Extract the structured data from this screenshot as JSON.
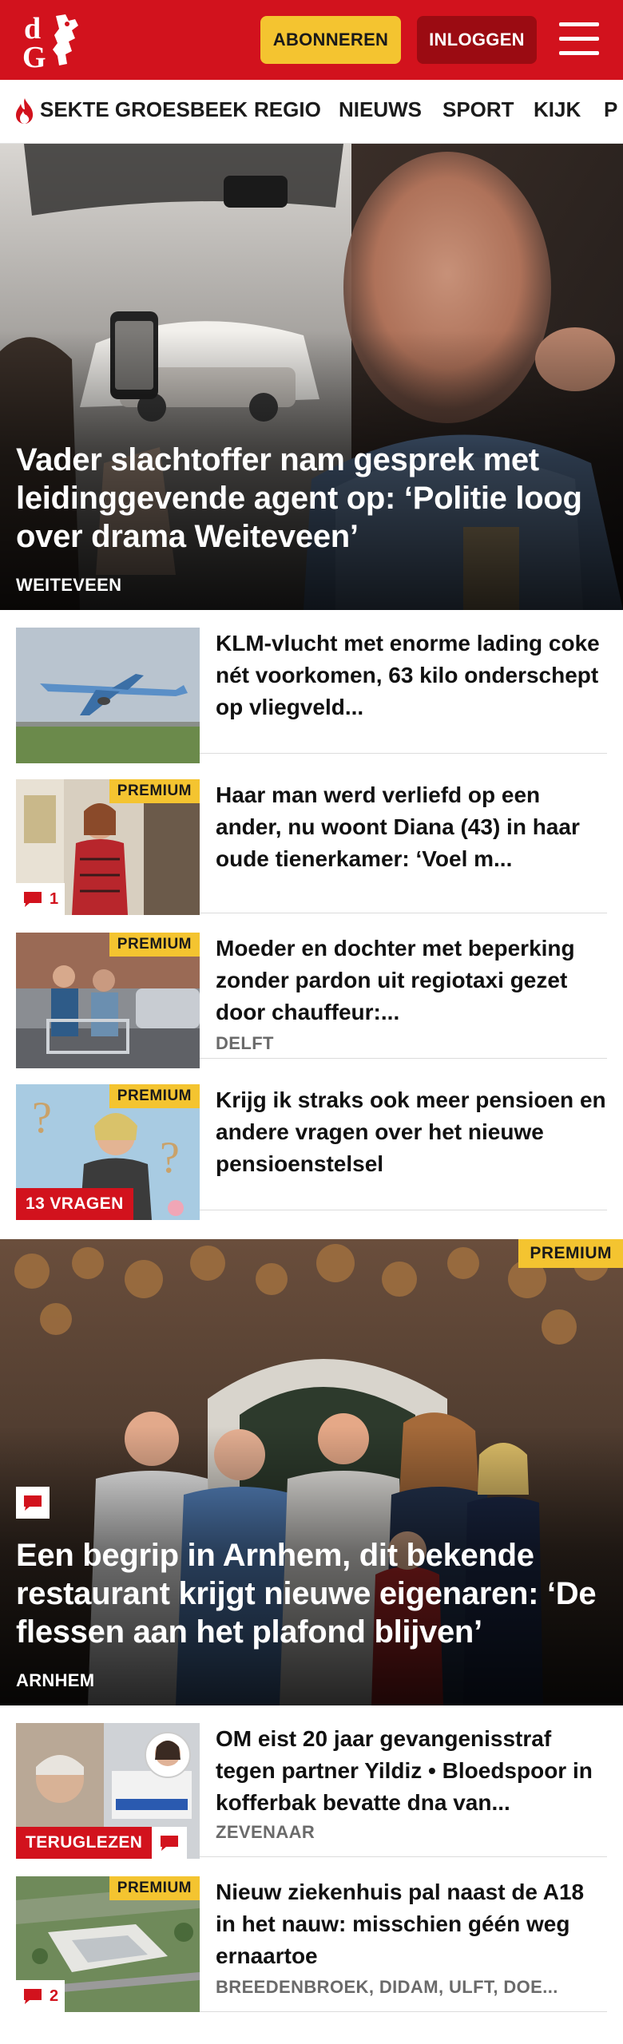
{
  "header": {
    "logo_text": "dG",
    "subscribe_label": "ABONNEREN",
    "login_label": "INLOGGEN"
  },
  "nav": {
    "items": [
      {
        "label": "SEKTE GROESBEEK",
        "icon": "flame-icon"
      },
      {
        "label": "REGIO"
      },
      {
        "label": "NIEUWS"
      },
      {
        "label": "SPORT"
      },
      {
        "label": "KIJK"
      },
      {
        "label": "P"
      }
    ]
  },
  "articles": {
    "hero1": {
      "title": "Vader slachtoffer nam gesprek met leidinggevende agent op: ‘Politie loog over drama Weiteveen’",
      "location": "WEITEVEEN"
    },
    "list1": [
      {
        "title": "KLM-vlucht met enorme lading coke nét voorkomen, 63 kilo onderschept op vliegveld...",
        "location": "",
        "premium": false,
        "comments": null,
        "tag": null
      },
      {
        "title": "Haar man werd verliefd op een ander, nu woont Diana (43) in haar oude tienerkamer: ‘Voel m...",
        "location": "",
        "premium": true,
        "premium_label": "PREMIUM",
        "comments": "1",
        "tag": null
      },
      {
        "title": "Moeder en dochter met beperking zonder pardon uit regiotaxi gezet door chauffeur:...",
        "location": "DELFT",
        "premium": true,
        "premium_label": "PREMIUM",
        "comments": null,
        "tag": null
      },
      {
        "title": "Krijg ik straks ook meer pensioen en andere vragen over het nieuwe pensioenstelsel",
        "location": "",
        "premium": true,
        "premium_label": "PREMIUM",
        "comments": null,
        "tag": "13 VRAGEN"
      }
    ],
    "hero2": {
      "title": "Een begrip in Arnhem, dit bekende restaurant krijgt nieuwe eigenaren: ‘De flessen aan het plafond blijven’",
      "location": "ARNHEM",
      "premium_label": "PREMIUM"
    },
    "list2": [
      {
        "title": "OM eist 20 jaar gevangenisstraf tegen partner Yildiz • Bloedspoor in kofferbak bevatte dna van...",
        "location": "ZEVENAAR",
        "premium": false,
        "tag": "TERUGLEZEN"
      },
      {
        "title": "Nieuw ziekenhuis pal naast de A18 in het nauw: misschien géén weg ernaartoe",
        "location": "BREEDENBROEK, DIDAM, ULFT, DOE...",
        "premium": true,
        "premium_label": "PREMIUM",
        "comments": "2"
      }
    ]
  },
  "colors": {
    "brand_red": "#d2121d",
    "dark_red": "#9b0b12",
    "premium_yellow": "#f4c430"
  }
}
